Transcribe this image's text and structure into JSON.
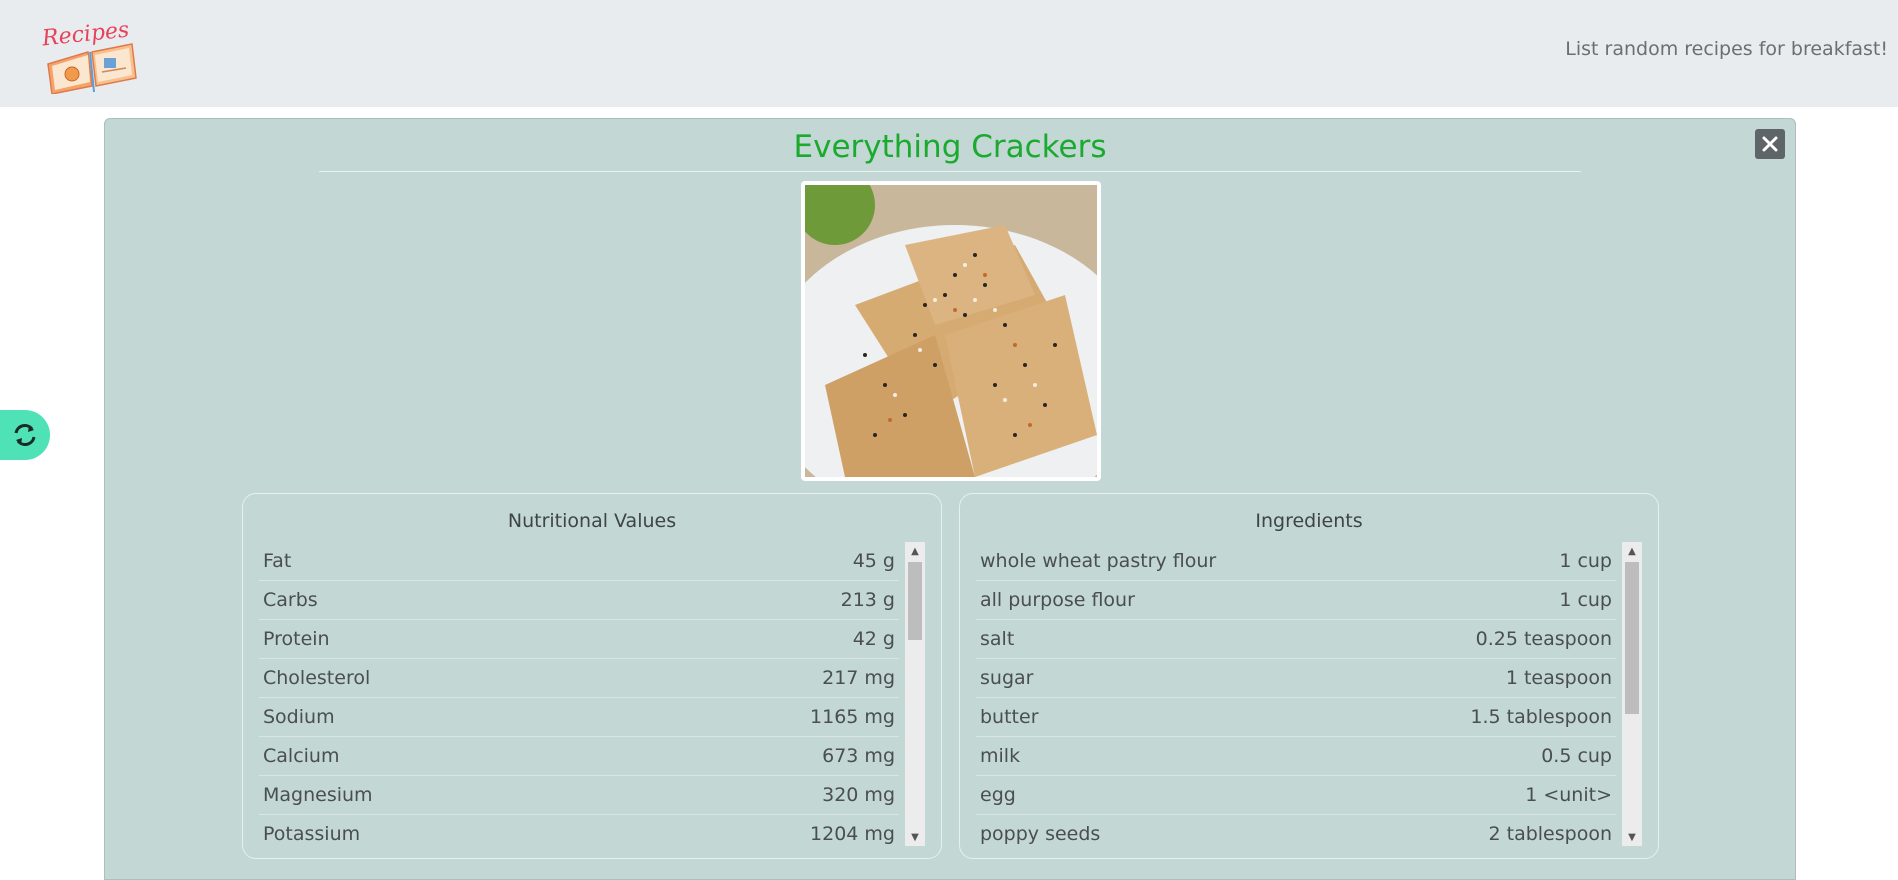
{
  "header": {
    "logo_text": "Recipes",
    "tagline": "List random recipes for breakfast!"
  },
  "recipe": {
    "title": "Everything Crackers"
  },
  "nutrition": {
    "title": "Nutritional Values",
    "rows": [
      {
        "name": "Fat",
        "value": "45 g"
      },
      {
        "name": "Carbs",
        "value": "213 g"
      },
      {
        "name": "Protein",
        "value": "42 g"
      },
      {
        "name": "Cholesterol",
        "value": "217 mg"
      },
      {
        "name": "Sodium",
        "value": "1165 mg"
      },
      {
        "name": "Calcium",
        "value": "673 mg"
      },
      {
        "name": "Magnesium",
        "value": "320 mg"
      },
      {
        "name": "Potassium",
        "value": "1204 mg"
      }
    ]
  },
  "ingredients": {
    "title": "Ingredients",
    "rows": [
      {
        "name": "whole wheat pastry flour",
        "value": "1 cup"
      },
      {
        "name": "all purpose flour",
        "value": "1 cup"
      },
      {
        "name": "salt",
        "value": "0.25 teaspoon"
      },
      {
        "name": "sugar",
        "value": "1 teaspoon"
      },
      {
        "name": "butter",
        "value": "1.5 tablespoon"
      },
      {
        "name": "milk",
        "value": "0.5 cup"
      },
      {
        "name": "egg",
        "value": "1 <unit>"
      },
      {
        "name": "poppy seeds",
        "value": "2 tablespoon"
      }
    ]
  },
  "colors": {
    "title_green": "#1aaa2e",
    "modal_bg": "#c3d7d5",
    "refresh_bg": "#4ee2b6"
  },
  "icons": {
    "refresh": "refresh-icon",
    "close": "close-icon"
  }
}
